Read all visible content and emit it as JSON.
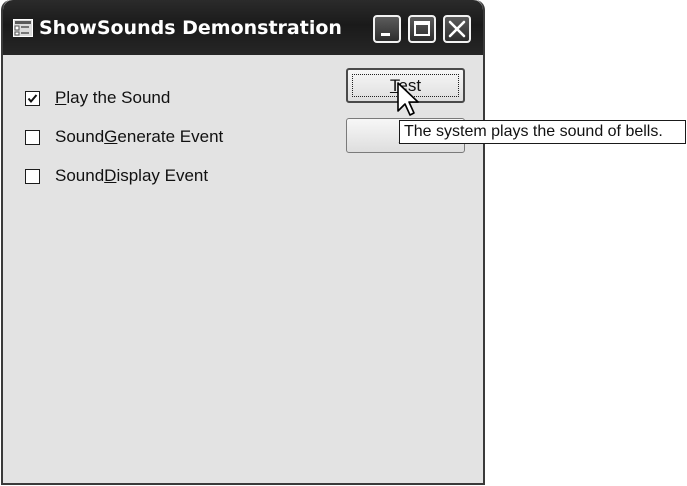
{
  "window": {
    "title": "ShowSounds Demonstration",
    "controls": {
      "minimize_icon": "minimize-icon",
      "maximize_icon": "maximize-icon",
      "close_icon": "close-icon"
    }
  },
  "checkboxes": [
    {
      "pre": "",
      "mnemonic": "P",
      "post": "lay the Sound",
      "checked": true
    },
    {
      "pre": "Sound",
      "mnemonic": "G",
      "post": "enerate Event",
      "checked": false
    },
    {
      "pre": "Sound",
      "mnemonic": "D",
      "post": "isplay Event",
      "checked": false
    }
  ],
  "buttons": {
    "test": {
      "pre": "",
      "mnemonic": "T",
      "post": "est"
    },
    "quit": {
      "pre": "",
      "mnemonic": "Q",
      "post": ""
    }
  },
  "tooltip": {
    "text": "The system plays the sound of bells."
  },
  "colors": {
    "titlebar": "#1a1a1a",
    "client": "#e3e3e3",
    "tooltip_bg": "#ffffff"
  }
}
